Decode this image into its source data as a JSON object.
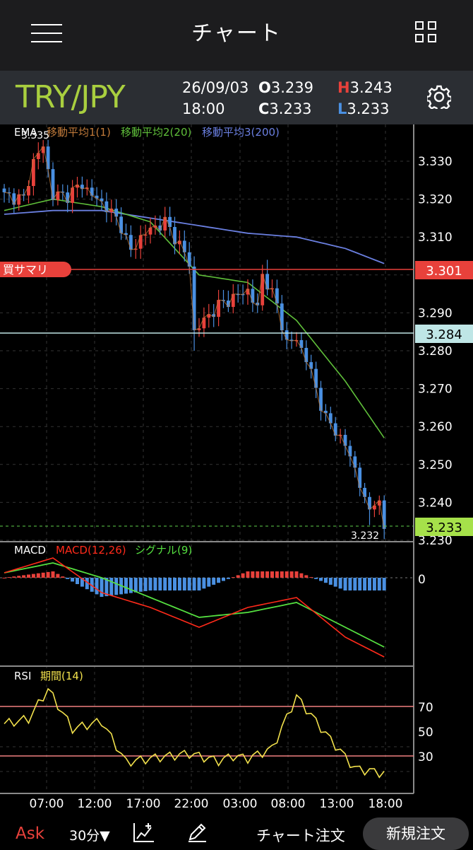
{
  "header": {
    "title": "チャート"
  },
  "info": {
    "pair": "TRY/JPY",
    "date": "26/09/03",
    "time": "18:00",
    "open_label": "O",
    "open": "3.239",
    "high_label": "H",
    "high": "3.243",
    "close_label": "C",
    "close": "3.233",
    "low_label": "L",
    "low": "3.233"
  },
  "colors": {
    "pair": "#a9cf3f",
    "up": "#e8413b",
    "down": "#4a90e2",
    "ma1": "#c07a3a",
    "ma2": "#5fbf3a",
    "ma3": "#6a7fe0",
    "macd": "#ff2a1a",
    "signal": "#55e040",
    "rsi": "#f2e14c",
    "rsi_band": "#f08080",
    "buy_summary": "#e8413b",
    "marker": "#bfe6e6",
    "last": "#a6e14a"
  },
  "main_panel": {
    "legend_label": "EMA",
    "ma1_label": "移動平均1(1)",
    "ma2_label": "移動平均2(20)",
    "ma3_label": "移動平均3(200)",
    "y_ticks": [
      "3.330",
      "3.320",
      "3.310",
      "3.300",
      "3.290",
      "3.280",
      "3.270",
      "3.260",
      "3.250",
      "3.240",
      "3.230"
    ],
    "high_annotation": "3.335",
    "low_annotation": "3.232",
    "buy_summary_label": "買サマリ",
    "buy_summary_price": "3.301",
    "marker_price": "3.284",
    "last_price": "3.233"
  },
  "macd_panel": {
    "label": "MACD",
    "macd_label": "MACD(12,26)",
    "signal_label": "シグナル(9)",
    "zero_tick": "0"
  },
  "rsi_panel": {
    "label": "RSI",
    "period_label": "期間(14)",
    "ticks": [
      "70",
      "50",
      "30"
    ]
  },
  "x_ticks": [
    "07:00",
    "12:00",
    "17:00",
    "22:00",
    "03:00",
    "08:00",
    "13:00",
    "18:00"
  ],
  "bottom": {
    "ask": "Ask",
    "timeframe": "30分▼",
    "chart_order": "チャート注文",
    "new_order": "新規注文"
  },
  "chart_data": [
    {
      "type": "candlestick",
      "title": "",
      "series": [
        {
          "name": "移動平均1(1)"
        },
        {
          "name": "移動平均2(20)",
          "x": [
            0,
            10,
            20,
            30,
            40,
            50,
            60,
            70,
            78
          ],
          "values": [
            3.317,
            3.32,
            3.318,
            3.314,
            3.3,
            3.298,
            3.288,
            3.272,
            3.257
          ]
        },
        {
          "name": "移動平均3(200)",
          "x": [
            0,
            10,
            20,
            30,
            40,
            50,
            60,
            70,
            78
          ],
          "values": [
            3.316,
            3.317,
            3.317,
            3.315,
            3.313,
            3.311,
            3.31,
            3.307,
            3.303
          ]
        }
      ],
      "ylim": [
        3.23,
        3.335
      ],
      "annotations": [
        "3.335",
        "3.232",
        "3.301",
        "3.284",
        "3.233"
      ]
    },
    {
      "type": "line",
      "series": [
        {
          "name": "MACD(12,26)",
          "x": [
            0,
            10,
            20,
            30,
            40,
            50,
            60,
            70,
            78
          ],
          "values": [
            0.001,
            0.004,
            -0.003,
            -0.006,
            -0.01,
            -0.006,
            -0.004,
            -0.012,
            -0.016
          ]
        },
        {
          "name": "シグナル(9)",
          "x": [
            0,
            10,
            20,
            30,
            40,
            50,
            60,
            70,
            78
          ],
          "values": [
            0.001,
            0.003,
            0.0,
            -0.004,
            -0.008,
            -0.007,
            -0.005,
            -0.01,
            -0.014
          ]
        }
      ]
    },
    {
      "type": "line",
      "series": [
        {
          "name": "期間(14)",
          "x": [
            0,
            5,
            9,
            14,
            20,
            25,
            30,
            38,
            44,
            47,
            50,
            55,
            60,
            66,
            72,
            78
          ],
          "values": [
            56,
            60,
            84,
            52,
            58,
            25,
            28,
            32,
            26,
            30,
            28,
            36,
            78,
            48,
            20,
            16
          ]
        }
      ],
      "ylim": [
        0,
        100
      ]
    }
  ]
}
